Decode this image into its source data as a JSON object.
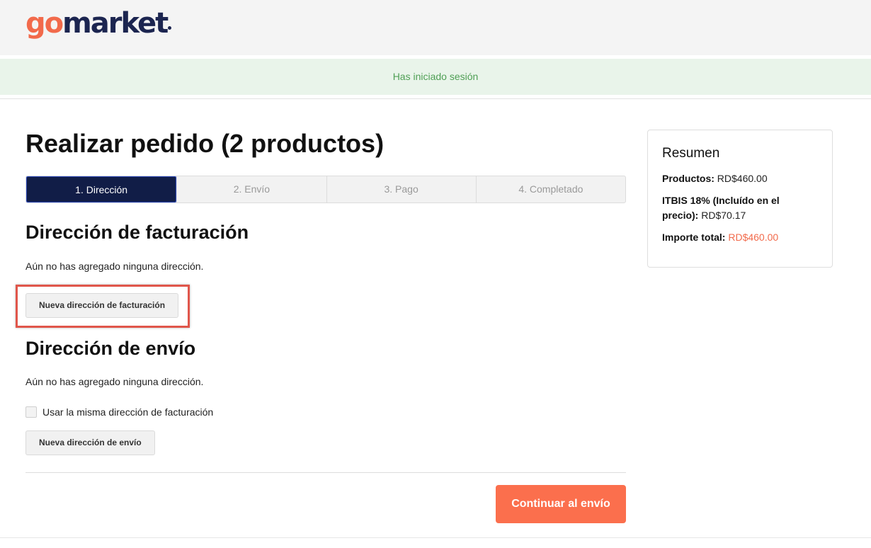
{
  "logo": {
    "go": "go",
    "market": "market",
    "accent_color": "#f26a4b",
    "brand_color": "#1c2550"
  },
  "flash": {
    "message": "Has iniciado sesión"
  },
  "page": {
    "title": "Realizar pedido (2 productos)"
  },
  "steps": [
    {
      "label": "1. Dirección",
      "active": true
    },
    {
      "label": "2. Envío",
      "active": false
    },
    {
      "label": "3. Pago",
      "active": false
    },
    {
      "label": "4. Completado",
      "active": false
    }
  ],
  "billing": {
    "title": "Dirección de facturación",
    "empty_note": "Aún no has agregado ninguna dirección.",
    "new_button": "Nueva dirección de facturación"
  },
  "shipping": {
    "title": "Dirección de envío",
    "empty_note": "Aún no has agregado ninguna dirección.",
    "same_address_label": "Usar la misma dirección de facturación",
    "same_address_checked": false,
    "new_button": "Nueva dirección de envío"
  },
  "continue_button": "Continuar al envío",
  "summary": {
    "title": "Resumen",
    "products_label": "Productos:",
    "products_value": "RD$460.00",
    "tax_label": "ITBIS 18% (Incluído en el precio):",
    "tax_value": "RD$70.17",
    "total_label": "Importe total:",
    "total_value": "RD$460.00"
  },
  "colors": {
    "primary_button": "#fb6f4d",
    "active_step": "#111d47",
    "flash_bg": "#e9f4ea",
    "flash_text": "#4f9f55",
    "highlight_border": "#e0564b"
  }
}
